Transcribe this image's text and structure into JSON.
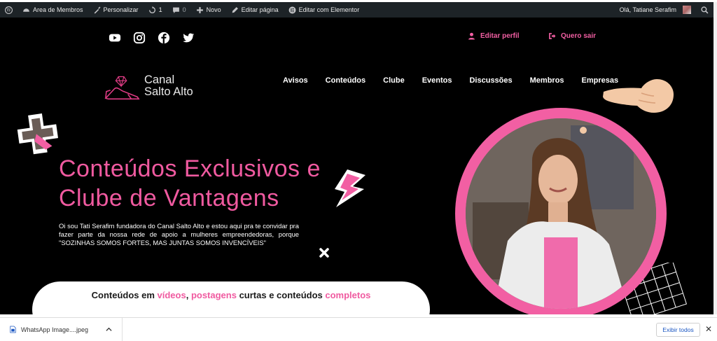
{
  "adminbar": {
    "items": [
      {
        "icon": "wordpress-icon",
        "label": ""
      },
      {
        "icon": "dashboard-icon",
        "label": "Area de Membros"
      },
      {
        "icon": "brush-icon",
        "label": "Personalizar"
      },
      {
        "icon": "updates-icon",
        "label": "1"
      },
      {
        "icon": "comment-icon",
        "label": "0"
      },
      {
        "icon": "plus-icon",
        "label": "Novo"
      },
      {
        "icon": "pencil-icon",
        "label": "Editar página"
      },
      {
        "icon": "elementor-icon",
        "label": "Editar com Elementor"
      }
    ],
    "greeting": "Olá, Tatiane Serafim"
  },
  "header": {
    "social": [
      "youtube-icon",
      "instagram-icon",
      "facebook-icon",
      "twitter-icon"
    ],
    "edit_profile": "Editar perfil",
    "logout": "Quero sair",
    "logo_line1": "Canal",
    "logo_line2": "Salto Alto",
    "nav": [
      "Avisos",
      "Conteúdos",
      "Clube",
      "Eventos",
      "Discussões",
      "Membros",
      "Empresas"
    ]
  },
  "hero": {
    "headline_line1": "Conteúdos Exclusivos e",
    "headline_line2": "Clube de Vantagens",
    "intro": "Oi sou Tati Serafim fundadora do Canal Salto Alto e estou aqui pra te convidar pra fazer parte da nossa rede de apoio a mulheres empreendedoras, porque \"SOZINHAS SOMOS FORTES, MAS JUNTAS SOMOS INVENCÍVEIS\"",
    "pill": {
      "t1": "Conteúdos em ",
      "t2": "vídeos",
      "t3": ", ",
      "t4": "postagens",
      "t5": " curtas e conteúdos ",
      "t6": "completos"
    }
  },
  "downloads": {
    "file_name": "WhatsApp Image....jpeg",
    "show_all": "Exibir todos",
    "close": "✕"
  },
  "colors": {
    "accent_pink": "#f05aa0",
    "admin_bar": "#1d2327",
    "hero_bg": "#000000"
  }
}
